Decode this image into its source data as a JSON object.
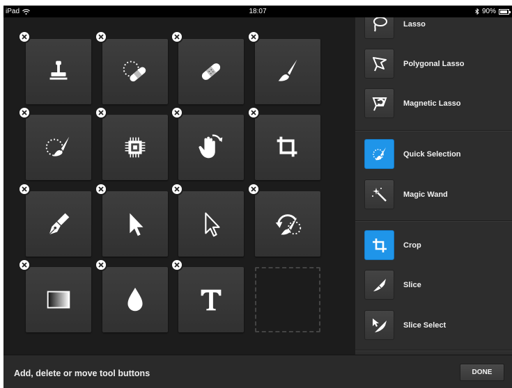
{
  "status_bar": {
    "device": "iPad",
    "time": "18:07",
    "battery": "90%"
  },
  "canvas": {
    "tiles": [
      {
        "icon": "stamp-icon"
      },
      {
        "icon": "spot-healing-brush-icon"
      },
      {
        "icon": "healing-bandage-icon"
      },
      {
        "icon": "brush-icon"
      },
      {
        "icon": "selection-brush-icon"
      },
      {
        "icon": "chip-icon"
      },
      {
        "icon": "hand-rotate-icon"
      },
      {
        "icon": "crop-icon"
      },
      {
        "icon": "pen-icon"
      },
      {
        "icon": "selection-arrow-icon"
      },
      {
        "icon": "direct-selection-arrow-icon"
      },
      {
        "icon": "history-brush-icon"
      },
      {
        "icon": "gradient-icon"
      },
      {
        "icon": "drop-icon"
      },
      {
        "icon": "type-icon"
      }
    ]
  },
  "panel": {
    "tools": [
      {
        "label": "Lasso",
        "icon": "lasso-icon",
        "selected": false
      },
      {
        "label": "Polygonal Lasso",
        "icon": "polygonal-lasso-icon",
        "selected": false
      },
      {
        "label": "Magnetic Lasso",
        "icon": "magnetic-lasso-icon",
        "selected": false
      },
      {
        "label": "Quick Selection",
        "icon": "quick-selection-icon",
        "selected": true
      },
      {
        "label": "Magic Wand",
        "icon": "magic-wand-icon",
        "selected": false
      },
      {
        "label": "Crop",
        "icon": "crop-icon",
        "selected": true
      },
      {
        "label": "Slice",
        "icon": "slice-icon",
        "selected": false
      },
      {
        "label": "Slice Select",
        "icon": "slice-select-icon",
        "selected": false
      }
    ]
  },
  "footer": {
    "instruction": "Add, delete or move tool buttons",
    "done_label": "DONE"
  },
  "colors": {
    "accent": "#1f95e9",
    "canvas_bg": "#1c1c1c",
    "panel_bg": "#2d2d2d"
  }
}
